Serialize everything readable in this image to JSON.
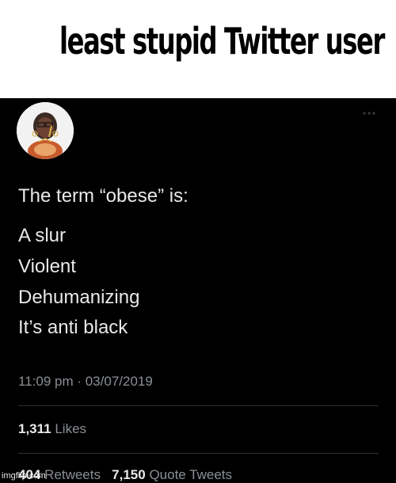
{
  "caption": {
    "text": "least stupid Twitter user"
  },
  "tweet": {
    "intro": "The term “obese” is:",
    "lines": [
      "A slur",
      "Violent",
      "Dehumanizing",
      "It’s anti black"
    ],
    "timestamp": "11:09 pm · 03/07/2019",
    "likes": {
      "count": "1,311",
      "label": "Likes"
    },
    "retweets": {
      "count": "404",
      "label": "Retweets"
    },
    "quote_tweets": {
      "count": "7,150",
      "label": "Quote Tweets"
    }
  },
  "watermark": {
    "text": "imgflip.com"
  },
  "colors": {
    "tweet_bg": "#000000",
    "text": "#e7e9ea",
    "secondary": "#8b8f95",
    "divider": "#2f3336"
  },
  "icons": {
    "more": "more-icon",
    "avatar": "avatar"
  }
}
